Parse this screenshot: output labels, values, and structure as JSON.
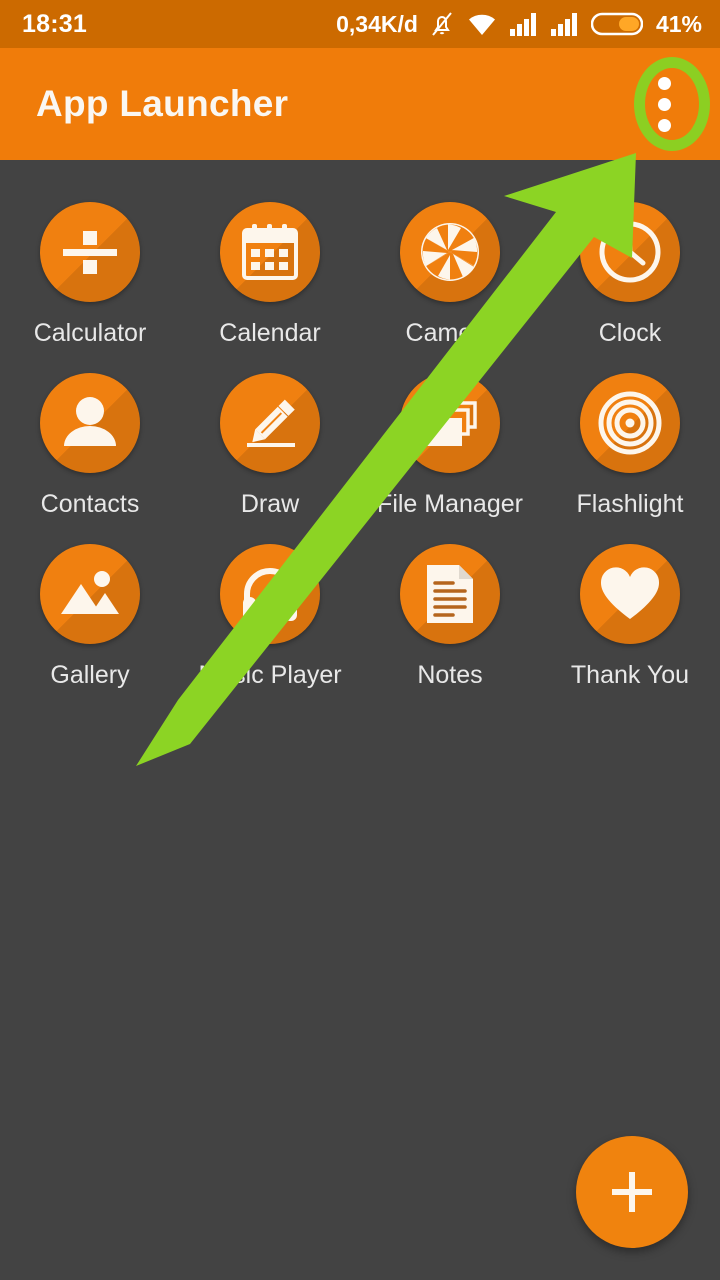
{
  "status_bar": {
    "clock": "18:31",
    "data_rate": "0,34K/d",
    "battery_percent": "41%",
    "icons": [
      "notification-silenced-icon",
      "wifi-icon",
      "signal-sim1-icon",
      "signal-sim2-icon",
      "battery-icon"
    ],
    "background_color": "#CC6A00"
  },
  "app_bar": {
    "title": "App Launcher",
    "overflow_menu_label": "More options",
    "background_color": "#F07C0A",
    "title_color": "#FAF7F2"
  },
  "annotations": {
    "highlight_color": "#8CCF22",
    "arrow_color": "#8CD424",
    "ellipse_target": "overflow-menu-button",
    "arrow_points_to": "overflow-menu-button"
  },
  "apps": [
    {
      "label": "Calculator",
      "icon": "divide-icon"
    },
    {
      "label": "Calendar",
      "icon": "calendar-icon"
    },
    {
      "label": "Camera",
      "icon": "aperture-icon"
    },
    {
      "label": "Clock",
      "icon": "clock-icon"
    },
    {
      "label": "Contacts",
      "icon": "person-icon"
    },
    {
      "label": "Draw",
      "icon": "pencil-icon"
    },
    {
      "label": "File Manager",
      "icon": "folders-icon"
    },
    {
      "label": "Flashlight",
      "icon": "concentric-rings-icon"
    },
    {
      "label": "Gallery",
      "icon": "image-mountain-icon"
    },
    {
      "label": "Music Player",
      "icon": "headphones-icon"
    },
    {
      "label": "Notes",
      "icon": "document-lines-icon"
    },
    {
      "label": "Thank You",
      "icon": "heart-icon"
    }
  ],
  "fab": {
    "label": "+",
    "accessible_name": "Add app",
    "background_color": "#F0830E"
  },
  "theme": {
    "background_color": "#434343",
    "icon_circle_color": "#F08010",
    "label_color": "#E8E8E8"
  }
}
